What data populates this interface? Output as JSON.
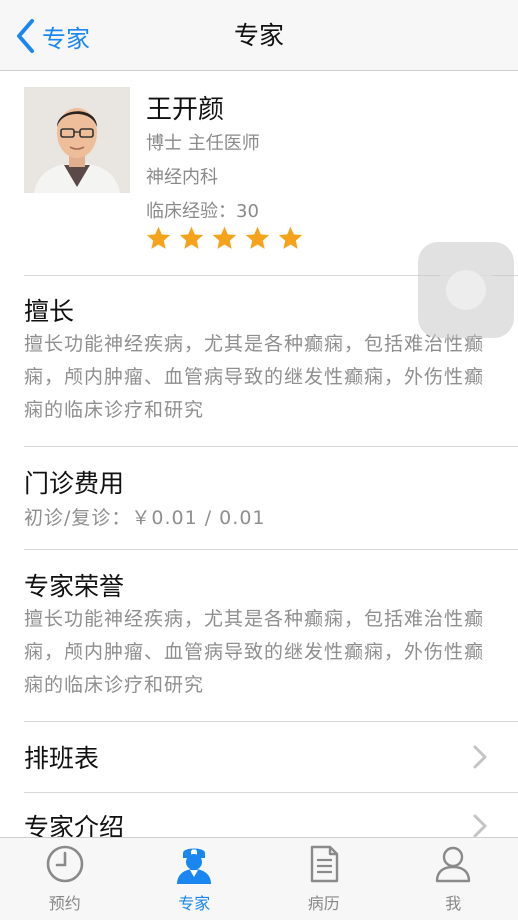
{
  "nav": {
    "back_label": "专家",
    "title": "专家"
  },
  "doctor": {
    "name": "王开颜",
    "title": "博士 主任医师",
    "department": "神经内科",
    "experience": "临床经验：30",
    "rating_stars": 5
  },
  "specialty": {
    "heading": "擅长",
    "text": "擅长功能神经疾病，尤其是各种癫痫，包括难治性癫痫，颅内肿瘤、血管病导致的继发性癫痫，外伤性癫痫的临床诊疗和研究"
  },
  "fees": {
    "heading": "门诊费用",
    "text": "初诊/复诊：￥0.01 / 0.01"
  },
  "honors": {
    "heading": "专家荣誉",
    "text": "擅长功能神经疾病，尤其是各种癫痫，包括难治性癫痫，颅内肿瘤、血管病导致的继发性癫痫，外伤性癫痫的临床诊疗和研究"
  },
  "rows": {
    "schedule": "排班表",
    "intro": "专家介绍"
  },
  "tabs": [
    {
      "label": "预约",
      "icon": "clock-icon"
    },
    {
      "label": "专家",
      "icon": "doctor-icon"
    },
    {
      "label": "病历",
      "icon": "document-icon"
    },
    {
      "label": "我",
      "icon": "person-icon"
    }
  ],
  "colors": {
    "accent": "#1a87f0",
    "star": "#f5a31a"
  }
}
